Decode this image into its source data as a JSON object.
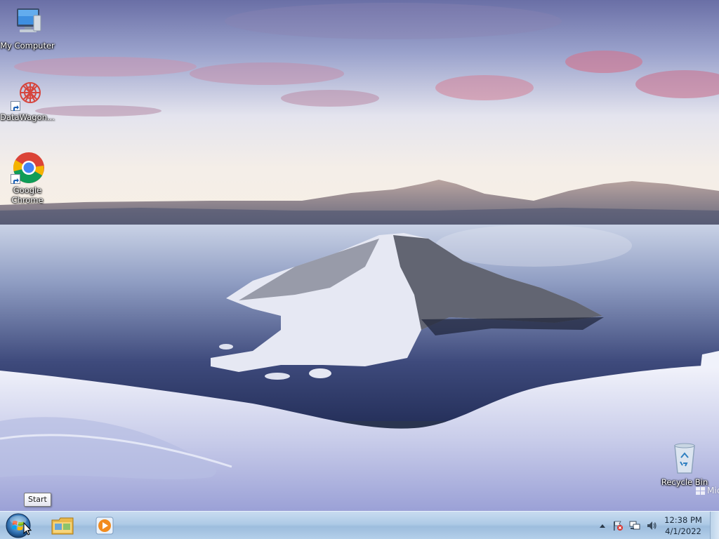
{
  "desktop": {
    "icons": [
      {
        "label": "My Computer",
        "icon": "computer-icon"
      },
      {
        "label": "DataWagon...",
        "icon": "datawagon-icon"
      },
      {
        "label": "Google Chrome",
        "icon": "chrome-icon"
      },
      {
        "label": "Recycle Bin",
        "icon": "recycle-bin-icon"
      }
    ],
    "watermark_text": "Mic"
  },
  "tooltip": {
    "start": "Start"
  },
  "taskbar": {
    "pinned": [
      {
        "name": "windows-explorer",
        "icon": "folder-icon"
      },
      {
        "name": "windows-media-player",
        "icon": "media-player-icon"
      }
    ]
  },
  "tray": {
    "icons": [
      "show-hidden-icons-arrow",
      "action-center-flag-icon",
      "network-icon",
      "volume-icon"
    ],
    "time": "12:38 PM",
    "date": "4/1/2022"
  },
  "colors": {
    "taskbar": "#aecae6",
    "chrome_red": "#db4437",
    "chrome_green": "#0f9d58",
    "chrome_yellow": "#f4b400",
    "chrome_blue": "#4285f4"
  }
}
